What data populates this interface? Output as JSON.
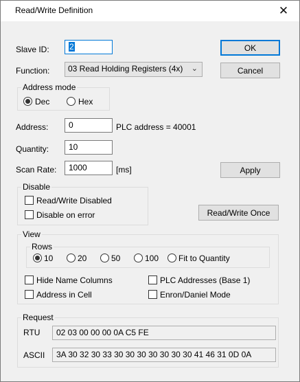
{
  "window": {
    "title": "Read/Write Definition",
    "close_glyph": "✕"
  },
  "labels": {
    "slave_id": "Slave ID:",
    "function": "Function:",
    "address": "Address:",
    "quantity": "Quantity:",
    "scan_rate": "Scan Rate:",
    "plc_address": "PLC address = 40001",
    "ms": "[ms]"
  },
  "fields": {
    "slave_id": "2",
    "address": "0",
    "quantity": "10",
    "scan_rate": "1000"
  },
  "function_select": {
    "value": "03 Read Holding Registers (4x)"
  },
  "buttons": {
    "ok": "OK",
    "cancel": "Cancel",
    "apply": "Apply",
    "read_write_once": "Read/Write Once"
  },
  "address_mode": {
    "title": "Address mode",
    "options": [
      "Dec",
      "Hex"
    ],
    "selected": "Dec"
  },
  "disable": {
    "title": "Disable",
    "options": [
      {
        "label": "Read/Write Disabled",
        "checked": false
      },
      {
        "label": "Disable on error",
        "checked": false
      }
    ]
  },
  "view": {
    "title": "View",
    "rows": {
      "title": "Rows",
      "options": [
        "10",
        "20",
        "50",
        "100",
        "Fit to Quantity"
      ],
      "selected": "10"
    },
    "checkboxes": [
      {
        "label": "Hide Name Columns",
        "checked": false
      },
      {
        "label": "PLC Addresses (Base 1)",
        "checked": false
      },
      {
        "label": "Address in Cell",
        "checked": false
      },
      {
        "label": "Enron/Daniel Mode",
        "checked": false
      }
    ]
  },
  "request": {
    "title": "Request",
    "rtu_label": "RTU",
    "rtu_value": "02 03 00 00 00 0A C5 FE",
    "ascii_label": "ASCII",
    "ascii_value": "3A 30 32 30 33 30 30 30 30 30 30 30 41 46 31 0D 0A"
  }
}
